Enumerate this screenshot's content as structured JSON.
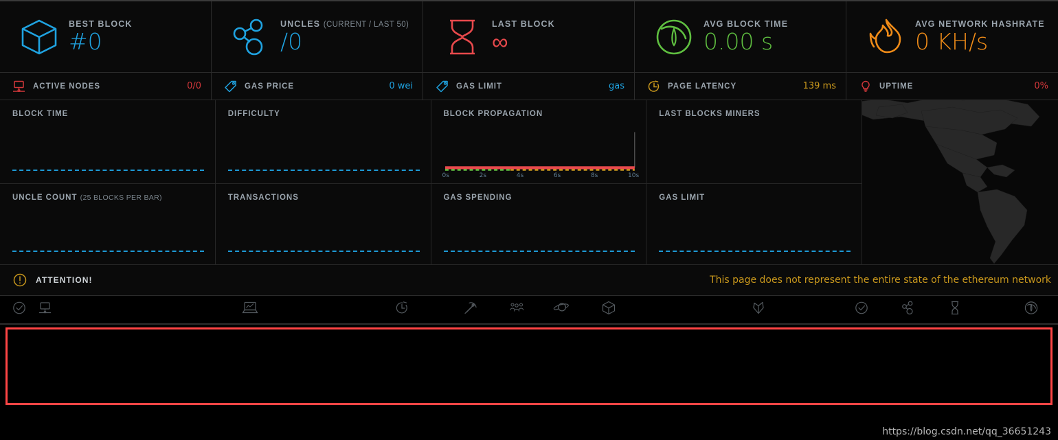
{
  "header_stats": [
    {
      "icon": "cube-icon",
      "label": "BEST BLOCK",
      "sublabel": "",
      "value": "#0",
      "color": "#1fa2e0",
      "sub_stat": {
        "icon": "monitor-nodes-icon",
        "label": "ACTIVE NODES",
        "value": "0/0",
        "color": "#d2373a"
      }
    },
    {
      "icon": "uncles-graph-icon",
      "label": "UNCLES",
      "sublabel": "(CURRENT / LAST 50)",
      "value": "/0",
      "color": "#1fa2e0",
      "sub_stat": {
        "icon": "gas-tag-icon",
        "label": "GAS PRICE",
        "value": "0 wei",
        "color": "#1fa2e0"
      }
    },
    {
      "icon": "hourglass-icon",
      "label": "LAST BLOCK",
      "sublabel": "",
      "value": "∞",
      "color": "#e8494c",
      "sub_stat": {
        "icon": "gas-tag-icon",
        "label": "GAS LIMIT",
        "value": "gas",
        "color": "#1fa2e0"
      }
    },
    {
      "icon": "gauge-icon",
      "label": "AVG BLOCK TIME",
      "sublabel": "",
      "value": "0.00 s",
      "color": "#5fbf40",
      "sub_stat": {
        "icon": "stopwatch-icon",
        "label": "PAGE LATENCY",
        "value": "139 ms",
        "color": "#c8971c"
      }
    },
    {
      "icon": "flame-icon",
      "label": "AVG NETWORK HASHRATE",
      "sublabel": "",
      "value": "0 KH/s",
      "color": "#ef8b18",
      "sub_stat": {
        "icon": "lightbulb-icon",
        "label": "UPTIME",
        "value": "0%",
        "color": "#d2373a"
      }
    }
  ],
  "charts": [
    {
      "title": "BLOCK TIME",
      "sublabel": "",
      "kind": "sparkline"
    },
    {
      "title": "DIFFICULTY",
      "sublabel": "",
      "kind": "sparkline"
    },
    {
      "title": "BLOCK PROPAGATION",
      "sublabel": "",
      "kind": "propagation"
    },
    {
      "title": "LAST BLOCKS MINERS",
      "sublabel": "",
      "kind": "empty"
    },
    {
      "title": "UNCLE COUNT",
      "sublabel": "(25 BLOCKS PER BAR)",
      "kind": "sparkline"
    },
    {
      "title": "TRANSACTIONS",
      "sublabel": "",
      "kind": "sparkline"
    },
    {
      "title": "GAS SPENDING",
      "sublabel": "",
      "kind": "sparkline"
    },
    {
      "title": "GAS LIMIT",
      "sublabel": "",
      "kind": "sparkline"
    }
  ],
  "chart_data": {
    "type": "line",
    "title": "BLOCK PROPAGATION",
    "xlabel": "",
    "ylabel": "",
    "xlim": [
      0,
      10
    ],
    "tick_labels": [
      "0s",
      "2s",
      "4s",
      "6s",
      "8s",
      "10s"
    ],
    "x": [
      0,
      2,
      4,
      6,
      8,
      10
    ],
    "grid": false,
    "legend": "none",
    "series": [
      {
        "name": "propagation",
        "color": "#e8494c",
        "values": [
          0,
          0,
          0,
          0,
          0,
          0
        ]
      },
      {
        "name": "propagation-fill-green",
        "color": "#5fbf40",
        "values": [
          0,
          0,
          0,
          0,
          0,
          0
        ]
      },
      {
        "name": "propagation-fill-amber",
        "color": "#c8971c",
        "values": [
          0,
          0,
          0,
          0,
          0,
          0
        ]
      }
    ]
  },
  "attention": {
    "icon": "exclamation-circle-icon",
    "label": "ATTENTION!",
    "message": "This page does not represent the entire state of the ethereum network"
  },
  "table_header_icons": [
    {
      "name": "check-circle-icon",
      "x": 18
    },
    {
      "name": "monitor-node-icon",
      "x": 56
    },
    {
      "name": "laptop-chart-icon",
      "x": 352
    },
    {
      "name": "stopwatch-icon",
      "x": 575
    },
    {
      "name": "pickaxe-icon",
      "x": 674
    },
    {
      "name": "peers-icon",
      "x": 740
    },
    {
      "name": "planet-icon",
      "x": 805
    },
    {
      "name": "cube-outline-icon",
      "x": 875
    },
    {
      "name": "diamond-icon",
      "x": 1093
    },
    {
      "name": "check-circle-icon",
      "x": 1244
    },
    {
      "name": "uncles-graph-icon",
      "x": 1312
    },
    {
      "name": "hourglass-icon",
      "x": 1380
    },
    {
      "name": "gauge-circle-icon",
      "x": 1490
    }
  ],
  "watermark": "https://blog.csdn.net/qq_36651243"
}
